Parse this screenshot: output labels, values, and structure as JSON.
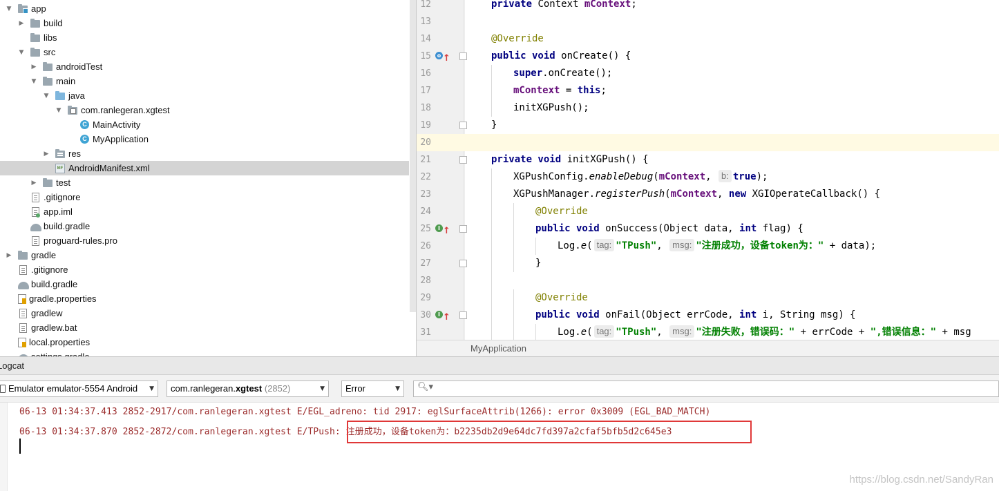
{
  "tree": {
    "items": [
      {
        "label": "app",
        "icon": "module-folder-icon",
        "arrow": "▼",
        "selected": false
      },
      {
        "label": "build",
        "icon": "folder-icon",
        "arrow": "▶",
        "selected": false
      },
      {
        "label": "libs",
        "icon": "folder-icon",
        "arrow": "",
        "selected": false
      },
      {
        "label": "src",
        "icon": "folder-icon",
        "arrow": "▼",
        "selected": false
      },
      {
        "label": "androidTest",
        "icon": "folder-icon",
        "arrow": "▶",
        "selected": false
      },
      {
        "label": "main",
        "icon": "folder-icon",
        "arrow": "▼",
        "selected": false
      },
      {
        "label": "java",
        "icon": "source-folder-icon",
        "arrow": "▼",
        "selected": false
      },
      {
        "label": "com.ranlegeran.xgtest",
        "icon": "package-icon",
        "arrow": "▼",
        "selected": false
      },
      {
        "label": "MainActivity",
        "icon": "class-icon",
        "arrow": "",
        "selected": false
      },
      {
        "label": "MyApplication",
        "icon": "class-icon",
        "arrow": "",
        "selected": false
      },
      {
        "label": "res",
        "icon": "resource-folder-icon",
        "arrow": "▶",
        "selected": false
      },
      {
        "label": "AndroidManifest.xml",
        "icon": "manifest-icon",
        "arrow": "",
        "selected": true
      },
      {
        "label": "test",
        "icon": "folder-icon",
        "arrow": "▶",
        "selected": false
      },
      {
        "label": ".gitignore",
        "icon": "text-file-icon",
        "arrow": "",
        "selected": false
      },
      {
        "label": "app.iml",
        "icon": "iml-file-icon",
        "arrow": "",
        "selected": false
      },
      {
        "label": "build.gradle",
        "icon": "gradle-icon",
        "arrow": "",
        "selected": false
      },
      {
        "label": "proguard-rules.pro",
        "icon": "text-file-icon",
        "arrow": "",
        "selected": false
      },
      {
        "label": "gradle",
        "icon": "folder-icon",
        "arrow": "▶",
        "selected": false
      },
      {
        "label": ".gitignore",
        "icon": "text-file-icon",
        "arrow": "",
        "selected": false
      },
      {
        "label": "build.gradle",
        "icon": "gradle-icon",
        "arrow": "",
        "selected": false
      },
      {
        "label": "gradle.properties",
        "icon": "properties-file-icon",
        "arrow": "",
        "selected": false
      },
      {
        "label": "gradlew",
        "icon": "text-file-icon",
        "arrow": "",
        "selected": false
      },
      {
        "label": "gradlew.bat",
        "icon": "text-file-icon",
        "arrow": "",
        "selected": false
      },
      {
        "label": "local.properties",
        "icon": "properties-file-icon",
        "arrow": "",
        "selected": false
      },
      {
        "label": "settings.gradle",
        "icon": "gradle-icon",
        "arrow": "",
        "selected": false
      }
    ]
  },
  "editor": {
    "breadcrumb": "MyApplication",
    "lines": [
      {
        "num": "12",
        "segments": [
          [
            "kw",
            "private "
          ],
          [
            "",
            "Context "
          ],
          [
            "field",
            "mContext"
          ],
          [
            "",
            ";"
          ]
        ]
      },
      {
        "num": "13",
        "segments": []
      },
      {
        "num": "14",
        "segments": [
          [
            "anno",
            "@Override"
          ]
        ]
      },
      {
        "num": "15",
        "segments": [
          [
            "kw",
            "public void "
          ],
          [
            "",
            "onCreate() {"
          ]
        ]
      },
      {
        "num": "16",
        "segments": [
          [
            "kw",
            "super"
          ],
          [
            "",
            ".onCreate();"
          ]
        ]
      },
      {
        "num": "17",
        "segments": [
          [
            "field",
            "mContext"
          ],
          [
            "",
            " = "
          ],
          [
            "kw",
            "this"
          ],
          [
            "",
            ";"
          ]
        ]
      },
      {
        "num": "18",
        "segments": [
          [
            "",
            "initXGPush();"
          ]
        ]
      },
      {
        "num": "19",
        "segments": [
          [
            "",
            "}"
          ]
        ]
      },
      {
        "num": "20",
        "segments": []
      },
      {
        "num": "21",
        "segments": [
          [
            "kw",
            "private void "
          ],
          [
            "",
            "initXGPush() {"
          ]
        ]
      },
      {
        "num": "22",
        "segments": [
          [
            "",
            "XGPushConfig."
          ],
          [
            "ital",
            "enableDebug"
          ],
          [
            "",
            "("
          ],
          [
            "field",
            "mContext"
          ],
          [
            "",
            ", "
          ],
          [
            "hint",
            "b:"
          ],
          [
            "kw",
            "true"
          ],
          [
            "",
            ");"
          ]
        ]
      },
      {
        "num": "23",
        "segments": [
          [
            "",
            "XGPushManager."
          ],
          [
            "ital",
            "registerPush"
          ],
          [
            "",
            "("
          ],
          [
            "field",
            "mContext"
          ],
          [
            "",
            ", "
          ],
          [
            "kw",
            "new "
          ],
          [
            "",
            "XGIOperateCallback() {"
          ]
        ]
      },
      {
        "num": "24",
        "segments": [
          [
            "anno",
            "@Override"
          ]
        ]
      },
      {
        "num": "25",
        "segments": [
          [
            "kw",
            "public void "
          ],
          [
            "",
            "onSuccess(Object data, "
          ],
          [
            "kw",
            "int "
          ],
          [
            "",
            "flag) {"
          ]
        ]
      },
      {
        "num": "26",
        "segments": [
          [
            "",
            "Log."
          ],
          [
            "ital",
            "e"
          ],
          [
            "",
            "("
          ],
          [
            "hint",
            "tag:"
          ],
          [
            "str",
            "\"TPush\""
          ],
          [
            "",
            ", "
          ],
          [
            "hint",
            "msg:"
          ],
          [
            "str",
            "\"注册成功，设备token为：\""
          ],
          [
            "",
            " + data);"
          ]
        ]
      },
      {
        "num": "27",
        "segments": [
          [
            "",
            "}"
          ]
        ]
      },
      {
        "num": "28",
        "segments": []
      },
      {
        "num": "29",
        "segments": [
          [
            "anno",
            "@Override"
          ]
        ]
      },
      {
        "num": "30",
        "segments": [
          [
            "kw",
            "public void "
          ],
          [
            "",
            "onFail(Object errCode, "
          ],
          [
            "kw",
            "int "
          ],
          [
            "",
            "i, String msg) {"
          ]
        ]
      },
      {
        "num": "31",
        "segments": [
          [
            "",
            "Log."
          ],
          [
            "ital",
            "e"
          ],
          [
            "",
            "("
          ],
          [
            "hint",
            "tag:"
          ],
          [
            "str",
            "\"TPush\""
          ],
          [
            "",
            ", "
          ],
          [
            "hint",
            "msg:"
          ],
          [
            "str",
            "\"注册失败，错误码：\""
          ],
          [
            "",
            " + errCode + "
          ],
          [
            "str",
            "\",错误信息：\""
          ],
          [
            "",
            " + msg"
          ]
        ]
      }
    ]
  },
  "logcat": {
    "title": "Logcat",
    "device": "Emulator emulator-5554 Android",
    "process_prefix": "com.ranlegeran.",
    "process_name": "xgtest",
    "process_pid": "(2852)",
    "level": "Error",
    "search_placeholder": "",
    "lines": [
      "06-13 01:34:37.413 2852-2917/com.ranlegeran.xgtest E/EGL_adreno: tid 2917: eglSurfaceAttrib(1266): error 0x3009 (EGL_BAD_MATCH)",
      "06-13 01:34:37.870 2852-2872/com.ranlegeran.xgtest E/TPush: 注册成功，设备token为：b2235db2d9e64dc7fd397a2cfaf5bfb5d2c645e3"
    ]
  },
  "watermark": "https://blog.csdn.net/SandyRan",
  "colors": {
    "keyword": "#000080",
    "field": "#660e7a",
    "annotation": "#808000",
    "string": "#008000",
    "log_error": "#9b2b2b",
    "highlight_box": "#e03838",
    "selection": "#d4d4d4"
  }
}
